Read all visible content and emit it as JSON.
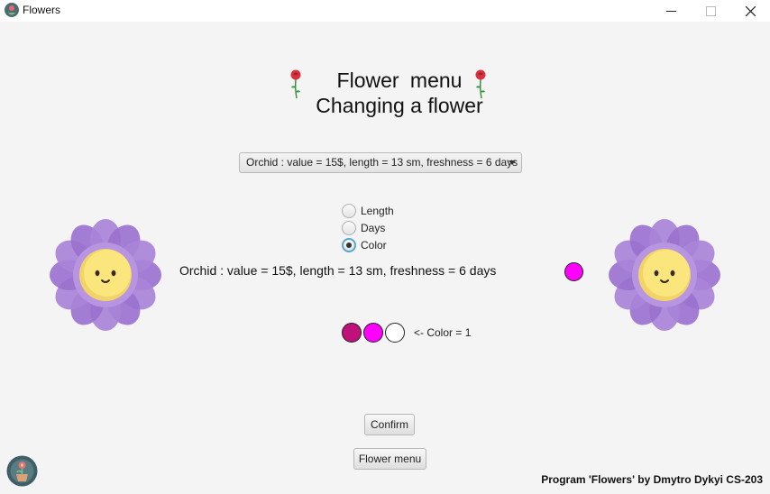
{
  "window": {
    "title": "Flowers",
    "app_icon": "flower-app-icon",
    "controls": [
      "minimize-icon",
      "maximize-icon",
      "close-icon"
    ]
  },
  "header": {
    "line1": "Flower  menu",
    "line2": "Changing a flower",
    "decoration_icon": "rose-icon"
  },
  "combo": {
    "selected": "Orchid : value = 15$, length = 13 sm, freshness = 6 days"
  },
  "radios": {
    "options": [
      {
        "label": "Length",
        "selected": false
      },
      {
        "label": "Days",
        "selected": false
      },
      {
        "label": "Color",
        "selected": true
      }
    ]
  },
  "info_text": "Orchid : value = 15$, length = 13 sm, freshness = 6 days",
  "colors": {
    "current": "#ff00ff",
    "swatches": [
      "#c0117a",
      "#ff00ff",
      "#ffffff"
    ],
    "note": "<- Color = 1"
  },
  "buttons": {
    "confirm": "Confirm",
    "flower_menu": "Flower menu"
  },
  "footer": {
    "credit": "Program 'Flowers' by Dmytro Dykyi CS-203",
    "logo_icon": "flower-pot-logo"
  },
  "decor": {
    "left_flower": "smiling-flower-icon",
    "right_flower": "smiling-flower-icon",
    "petal_color": "#a983d8",
    "center_color": "#fbe67e"
  }
}
